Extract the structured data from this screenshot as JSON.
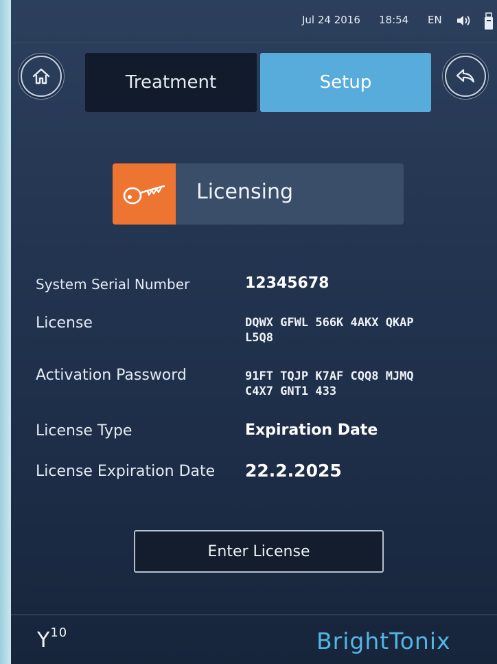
{
  "status": {
    "date": "Jul 24 2016",
    "time": "18:54",
    "language": "EN"
  },
  "nav": {
    "home_icon": "home-icon",
    "back_icon": "back-arrow-icon",
    "tabs": [
      {
        "label": "Treatment",
        "active": false
      },
      {
        "label": "Setup",
        "active": true
      }
    ]
  },
  "section": {
    "title": "Licensing",
    "icon": "key-icon",
    "accent": "#ee7431"
  },
  "info": {
    "serial_label": "System Serial Number",
    "serial_value": "12345678",
    "license_label": "License",
    "license_line1": "DQWX GFWL 566K 4AKX QKAP",
    "license_line2": "L5Q8",
    "activation_label": "Activation Password",
    "activation_line1": "91FT TQJP K7AF CQQ8 MJMQ",
    "activation_line2": "C4X7 GNT1 433",
    "type_label": "License Type",
    "type_value": "Expiration Date",
    "expiration_label": "License Expiration Date",
    "expiration_value": "22.2.2025"
  },
  "actions": {
    "enter_license": "Enter License"
  },
  "footer": {
    "model_base": "Y",
    "model_sup": "10",
    "brand_part1": "Bright",
    "brand_part2": "Tonix",
    "brand_color": "#55b5e4"
  }
}
